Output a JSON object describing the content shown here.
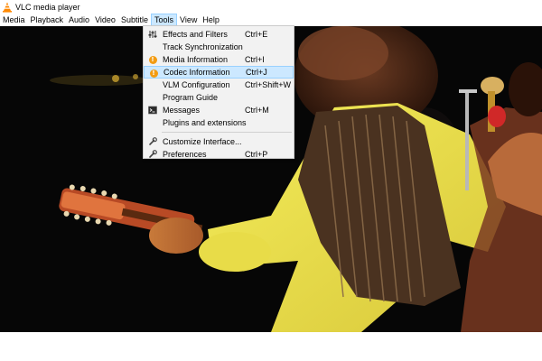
{
  "window": {
    "title": "VLC media player"
  },
  "menubar": {
    "items": [
      {
        "id": "media",
        "label": "Media"
      },
      {
        "id": "playback",
        "label": "Playback"
      },
      {
        "id": "audio",
        "label": "Audio"
      },
      {
        "id": "video",
        "label": "Video"
      },
      {
        "id": "subtitle",
        "label": "Subtitle"
      },
      {
        "id": "tools",
        "label": "Tools"
      },
      {
        "id": "view",
        "label": "View"
      },
      {
        "id": "help",
        "label": "Help"
      }
    ]
  },
  "tools_menu": {
    "items": [
      {
        "label": "Effects and Filters",
        "shortcut": "Ctrl+E",
        "icon": "equalizer-icon"
      },
      {
        "label": "Track Synchronization",
        "shortcut": "",
        "icon": ""
      },
      {
        "label": "Media Information",
        "shortcut": "Ctrl+I",
        "icon": "info-icon"
      },
      {
        "label": "Codec Information",
        "shortcut": "Ctrl+J",
        "icon": "info-icon",
        "highlighted": true
      },
      {
        "label": "VLM Configuration",
        "shortcut": "Ctrl+Shift+W",
        "icon": ""
      },
      {
        "label": "Program Guide",
        "shortcut": "",
        "icon": ""
      },
      {
        "label": "Messages",
        "shortcut": "Ctrl+M",
        "icon": "terminal-icon"
      },
      {
        "label": "Plugins and extensions",
        "shortcut": "",
        "icon": ""
      },
      {
        "label": "Customize Interface...",
        "shortcut": "",
        "icon": "wrench-icon"
      },
      {
        "label": "Preferences",
        "shortcut": "Ctrl+P",
        "icon": "wrench-icon"
      }
    ]
  },
  "colors": {
    "highlight_bg": "#cce8ff",
    "highlight_border": "#99d1ff",
    "info_icon": "#f39c12",
    "vlc_orange": "#ff8800"
  }
}
